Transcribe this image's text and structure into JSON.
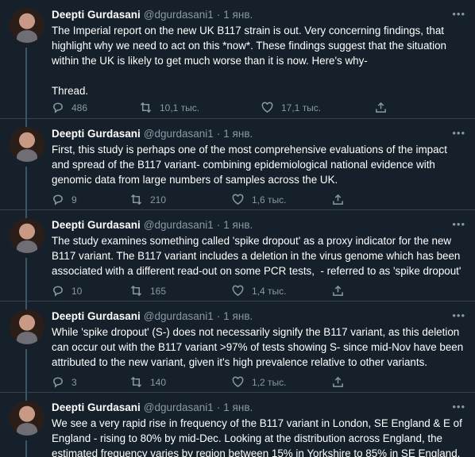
{
  "tweets": [
    {
      "name": "Deepti Gurdasani",
      "handle": "@dgurdasani1",
      "time": "1 янв.",
      "more": "•••",
      "text": "The Imperial report on the new UK B117 strain is out. Very concerning findings, that highlight why we need to act on this *now*. These findings suggest that the situation within the UK is likely to get much worse than it is now. Here's why-\n\nThread.",
      "replies": "486",
      "retweets": "10,1 тыс.",
      "likes": "17,1 тыс."
    },
    {
      "name": "Deepti Gurdasani",
      "handle": "@dgurdasani1",
      "time": "1 янв.",
      "more": "•••",
      "text": "First, this study is perhaps one of the most comprehensive evaluations of the impact and spread of the B117 variant- combining epidemiological national evidence with genomic data from large numbers of samples across the UK.",
      "replies": "9",
      "retweets": "210",
      "likes": "1,6 тыс."
    },
    {
      "name": "Deepti Gurdasani",
      "handle": "@dgurdasani1",
      "time": "1 янв.",
      "more": "•••",
      "text": "The study examines something called 'spike dropout' as a proxy indicator for the new B117 variant. The B117 variant includes a deletion in the virus genome which has been associated with a different read-out on some PCR tests,  - referred to as 'spike dropout'",
      "replies": "10",
      "retweets": "165",
      "likes": "1,4 тыс."
    },
    {
      "name": "Deepti Gurdasani",
      "handle": "@dgurdasani1",
      "time": "1 янв.",
      "more": "•••",
      "text": "While 'spike dropout' (S-) does not necessarily signify the B117 variant, as this deletion can occur out with the B117 variant >97% of tests showing S- since mid-Nov have been attributed to the new variant, given it's high prevalence relative to other variants.",
      "replies": "3",
      "retweets": "140",
      "likes": "1,2 тыс."
    },
    {
      "name": "Deepti Gurdasani",
      "handle": "@dgurdasani1",
      "time": "1 янв.",
      "more": "•••",
      "text": "We see a very rapid rise in frequency of the B117 variant in London, SE England & E of England - rising to 80% by mid-Dec. Looking at the distribution across England, the estimated frequency varies by region between 15% in Yorkshire to 85% in SE England.",
      "replies": "",
      "retweets": "",
      "likes": ""
    }
  ],
  "icons": {
    "reply": "reply-icon",
    "retweet": "retweet-icon",
    "like": "like-icon",
    "share": "share-icon",
    "more": "more-icon"
  },
  "colors": {
    "background": "#15202b",
    "muted": "#8899a6",
    "border": "#38444d",
    "thread_line": "#3d5466"
  }
}
